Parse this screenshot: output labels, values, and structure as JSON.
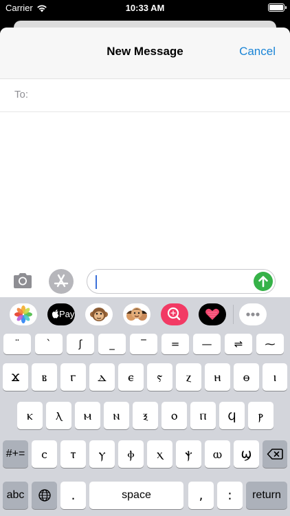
{
  "status_bar": {
    "carrier": "Carrier",
    "time": "10:33 AM"
  },
  "compose": {
    "title": "New Message",
    "cancel_label": "Cancel",
    "to_label": "To:"
  },
  "input_bar": {
    "message_value": ""
  },
  "app_strip": [
    {
      "name": "photos-app-icon"
    },
    {
      "name": "apple-pay-app-icon",
      "label": "Pay"
    },
    {
      "name": "monkey-memoji-icon"
    },
    {
      "name": "memoji-stickers-icon"
    },
    {
      "name": "image-search-app-icon"
    },
    {
      "name": "digital-touch-app-icon"
    },
    {
      "name": "more-apps-icon"
    }
  ],
  "keyboard": {
    "row1": [
      "¨",
      "`",
      "ʃ",
      "_",
      "‾",
      "=",
      "—",
      "⇌",
      "⁓"
    ],
    "row2": [
      "ϫ",
      "ⲃ",
      "ⲅ",
      "ⲇ",
      "ⲉ",
      "ⲋ",
      "ⲍ",
      "ⲏ",
      "ⲑ",
      "ⲓ"
    ],
    "row3": [
      "ⲕ",
      "ⲗ",
      "ⲙ",
      "ⲛ",
      "ⲝ",
      "ⲟ",
      "ⲡ",
      "ϥ",
      "ⲣ"
    ],
    "row4": [
      "ⲥ",
      "ⲧ",
      "ⲩ",
      "ⲫ",
      "ⲭ",
      "ⲯ",
      "ⲱ",
      "ϣ"
    ],
    "symbols_label": "#+=",
    "abc_label": "abc",
    "period_label": ".",
    "space_label": "space",
    "comma_label": ",",
    "colon_label": ":",
    "return_label": "return"
  }
}
